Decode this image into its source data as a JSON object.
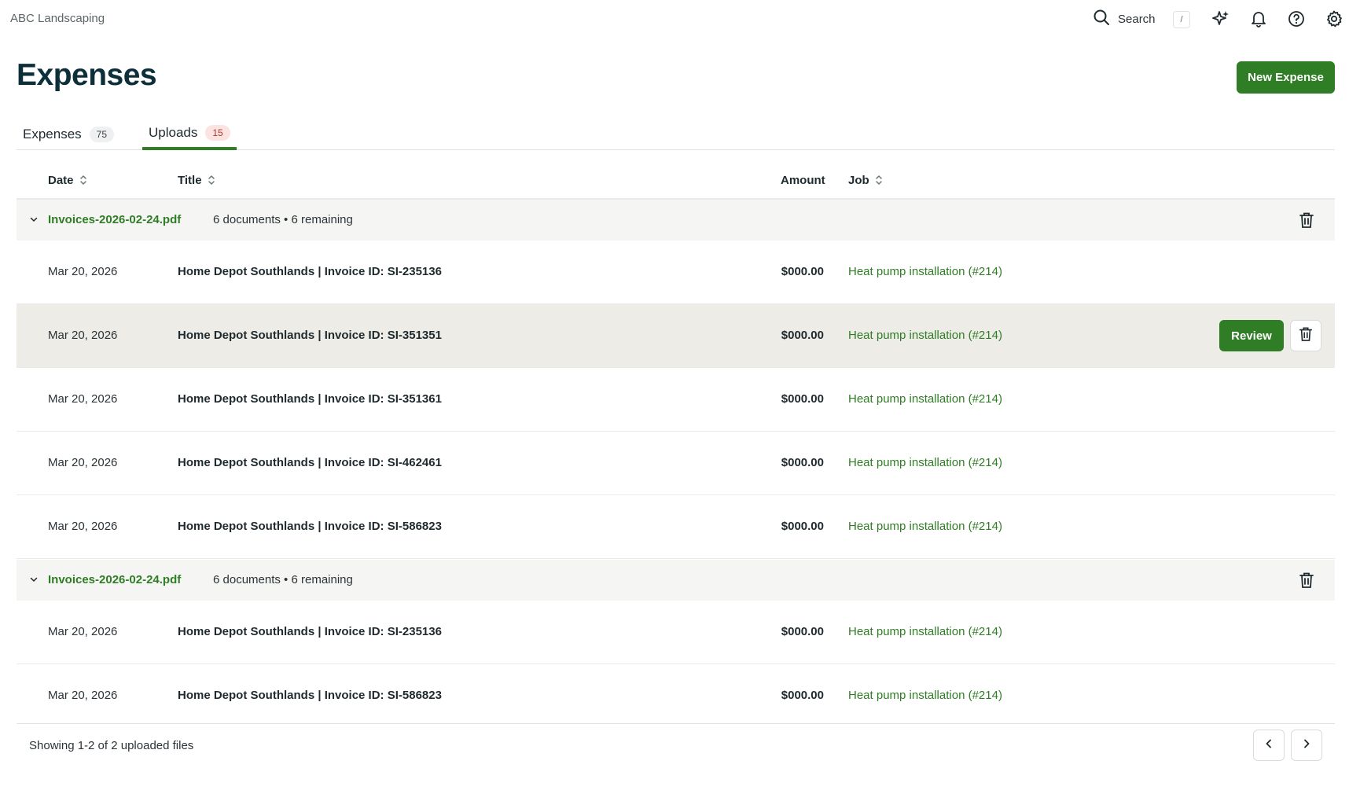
{
  "header": {
    "company": "ABC Landscaping",
    "search_label": "Search",
    "search_shortcut": "/"
  },
  "page": {
    "title": "Expenses",
    "new_button": "New Expense"
  },
  "tabs": [
    {
      "label": "Expenses",
      "count": "75",
      "active": false
    },
    {
      "label": "Uploads",
      "count": "15",
      "active": true
    }
  ],
  "columns": {
    "date": "Date",
    "title": "Title",
    "amount": "Amount",
    "job": "Job"
  },
  "groups": [
    {
      "filename": "Invoices-2026-02-24.pdf",
      "meta": "6 documents • 6 remaining",
      "rows": [
        {
          "date": "Mar 20, 2026",
          "title": "Home Depot Southlands | Invoice ID: SI-235136",
          "amount": "$000.00",
          "job": "Heat pump installation (#214)"
        },
        {
          "date": "Mar 20, 2026",
          "title": "Home Depot Southlands | Invoice ID: SI-351351",
          "amount": "$000.00",
          "job": "Heat pump installation (#214)",
          "review_label": "Review"
        },
        {
          "date": "Mar 20, 2026",
          "title": "Home Depot Southlands | Invoice ID: SI-351361",
          "amount": "$000.00",
          "job": "Heat pump installation (#214)"
        },
        {
          "date": "Mar 20, 2026",
          "title": "Home Depot Southlands | Invoice ID: SI-462461",
          "amount": "$000.00",
          "job": "Heat pump installation (#214)"
        },
        {
          "date": "Mar 20, 2026",
          "title": "Home Depot Southlands | Invoice ID: SI-586823",
          "amount": "$000.00",
          "job": "Heat pump installation (#214)"
        }
      ]
    },
    {
      "filename": "Invoices-2026-02-24.pdf",
      "meta": "6 documents • 6 remaining",
      "rows": [
        {
          "date": "Mar 20, 2026",
          "title": "Home Depot Southlands | Invoice ID: SI-235136",
          "amount": "$000.00",
          "job": "Heat pump installation (#214)"
        },
        {
          "date": "Mar 20, 2026",
          "title": "Home Depot Southlands | Invoice ID: SI-586823",
          "amount": "$000.00",
          "job": "Heat pump installation (#214)"
        }
      ]
    }
  ],
  "footer": {
    "showing": "Showing 1-2 of 2 uploaded files"
  },
  "colors": {
    "brand_green": "#2f7d24",
    "title_navy": "#0d2f3a",
    "badge_neutral_bg": "#eef0f1",
    "badge_alert_bg": "#fbe3e1",
    "badge_alert_text": "#b0372c",
    "row_highlight": "#edece7",
    "group_bg": "#f5f5f3"
  },
  "icons": [
    "search-icon",
    "sparkle-icon",
    "bell-icon",
    "help-icon",
    "gear-icon",
    "sort-icon",
    "chevron-down-icon",
    "trash-icon",
    "chevron-left-icon",
    "chevron-right-icon"
  ]
}
